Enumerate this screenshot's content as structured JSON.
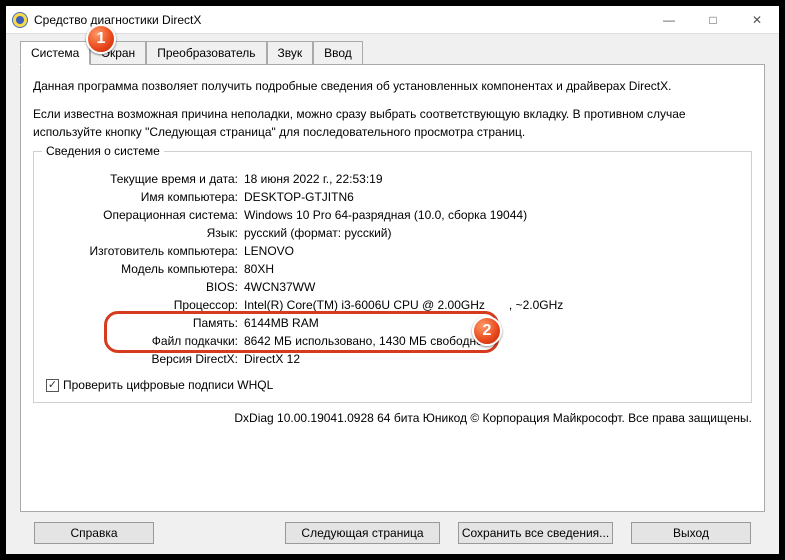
{
  "titlebar": {
    "title": "Средство диагностики DirectX"
  },
  "tabs": {
    "system": "Система",
    "screen": "Экран",
    "converter": "Преобразователь",
    "sound": "Звук",
    "input": "Ввод"
  },
  "intro": {
    "p1": "Данная программа позволяет получить подробные сведения об установленных компонентах и драйверах DirectX.",
    "p2": "Если известна возможная причина неполадки, можно сразу выбрать соответствующую вкладку. В противном случае используйте кнопку \"Следующая страница\" для последовательного просмотра страниц."
  },
  "group": {
    "legend": "Сведения о системе"
  },
  "rows": {
    "datetime_k": "Текущие время и дата:",
    "datetime_v": "18 июня 2022 г., 22:53:19",
    "pcname_k": "Имя компьютера:",
    "pcname_v": "DESKTOP-GTJITN6",
    "os_k": "Операционная система:",
    "os_v": "Windows 10 Pro 64-разрядная (10.0, сборка 19044)",
    "lang_k": "Язык:",
    "lang_v": "русский (формат: русский)",
    "manuf_k": "Изготовитель компьютера:",
    "manuf_v": "LENOVO",
    "model_k": "Модель компьютера:",
    "model_v": "80XH",
    "bios_k": "BIOS:",
    "bios_v": "4WCN37WW",
    "cpu_k": "Процессор:",
    "cpu_va": "Intel(R) Core(TM) i3-6006U CPU @ 2.00GHz",
    "cpu_vb": ", ~2.0GHz",
    "mem_k": "Память:",
    "mem_v": "6144MB RAM",
    "page_k": "Файл подкачки:",
    "page_v": "8642 МБ использовано, 1430 МБ свободно",
    "dx_k": "Версия DirectX:",
    "dx_v": "DirectX 12"
  },
  "whql": {
    "label": "Проверить цифровые подписи WHQL",
    "checked": true
  },
  "footer": "DxDiag 10.00.19041.0928 64 бита Юникод © Корпорация Майкрософт. Все права защищены.",
  "buttons": {
    "help": "Справка",
    "next": "Следующая страница",
    "save": "Сохранить все сведения...",
    "exit": "Выход"
  },
  "markers": {
    "one": "1",
    "two": "2"
  }
}
